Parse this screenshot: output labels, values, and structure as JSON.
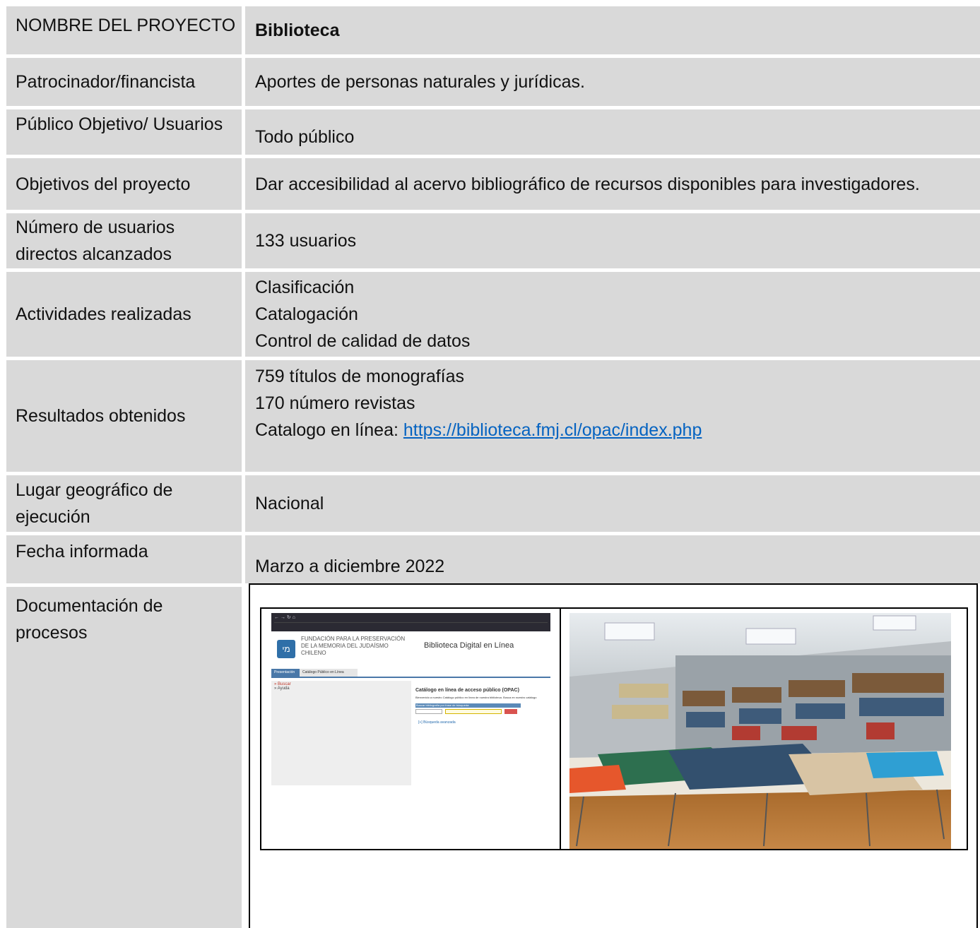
{
  "rows": [
    {
      "label": "NOMBRE DEL PROYECTO",
      "value": "Biblioteca"
    },
    {
      "label": "Patrocinador/financista",
      "value": "Aportes de personas naturales y jurídicas."
    },
    {
      "label": "Público Objetivo/ Usuarios",
      "value": "Todo público"
    },
    {
      "label": "Objetivos del proyecto",
      "value": "Dar accesibilidad al acervo bibliográfico de recursos disponibles para investigadores."
    },
    {
      "label": "Número de usuarios directos alcanzados",
      "value": "133 usuarios"
    },
    {
      "label": "Actividades realizadas",
      "lines": [
        "Clasificación",
        "Catalogación",
        "Control de calidad de datos"
      ]
    },
    {
      "label": "Resultados obtenidos",
      "lines": [
        "759 títulos de monografías",
        "170 número revistas"
      ],
      "link_prefix": "Catalogo en línea: ",
      "link_text": "https://biblioteca.fmj.cl/opac/index.php"
    },
    {
      "label": "Lugar geográfico de ejecución",
      "value": "Nacional"
    },
    {
      "label": "Fecha informada",
      "value": "Marzo a diciembre 2022"
    },
    {
      "label": "Documentación de procesos"
    }
  ],
  "screenshot": {
    "org_lines": [
      "FUNDACIÓN PARA LA PRESERVACIÓN",
      "DE LA MEMORIA DEL JUDAÍSMO",
      "CHILENO"
    ],
    "site_title": "Biblioteca Digital en Línea",
    "tab_home": "Presentación",
    "tab_catalog": "Catálogo Público en Línea",
    "left_links": [
      "» Buscar",
      "» Ayuda"
    ],
    "opac_title": "Catálogo en línea de acceso público (OPAC)",
    "opac_text": "Bienvenido a nuestro Catálogo público en línea de nuestra biblioteca. Busca en nuestro catálogo",
    "search_header": "Buscar bibliografía por frase de búsqueda:",
    "advanced": "[+] Búsqueda avanzada"
  },
  "colors": {
    "cell_bg": "#d9d9d9",
    "link": "#0563c1"
  }
}
